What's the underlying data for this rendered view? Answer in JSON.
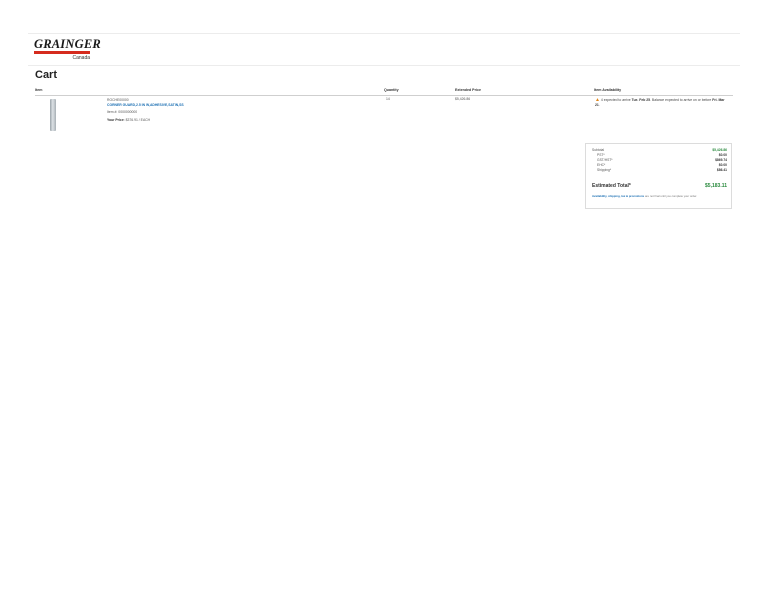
{
  "header": {
    "logo_word": "GRAINGER",
    "logo_sub": "Canada",
    "brand_color": "#d52b1e"
  },
  "page_title": "Cart",
  "columns": {
    "item": "Item",
    "quantity": "Quantity",
    "extended_price": "Extended Price",
    "availability": "Item Availability"
  },
  "line_item": {
    "image_icon": "corner-guard-product-image",
    "part_number": "ROCHE00000",
    "product_name": "CORNER GUARD,2.5 IN W,ADHESIVE,SATIN,SS",
    "item_number": "Item #: 0000000000",
    "price_label": "Your Price",
    "price_value": ": $376.91 / EACH",
    "quantity": "14",
    "extended_price": "$5,426.86",
    "availability": {
      "icon": "warning-icon",
      "prefix": "4 expected to arrive",
      "date1": "Tue. Feb 25",
      "middle": ". Balance expected to arrive on or before",
      "date2": "Fri. Mar 21",
      "suffix": "."
    }
  },
  "summary": {
    "rows": [
      {
        "label": "Subtotal",
        "value": "$5,426.86",
        "green": true,
        "indent": false
      },
      {
        "label": "PST*",
        "value": "$0.00",
        "green": false,
        "indent": true
      },
      {
        "label": "GST/HST*",
        "value": "$869.74",
        "green": false,
        "indent": true
      },
      {
        "label": "EHC*",
        "value": "$0.00",
        "green": false,
        "indent": true
      },
      {
        "label": "Shipping*",
        "value": "$86.41",
        "green": false,
        "indent": true
      }
    ],
    "estimated_total_label": "Estimated Total*",
    "estimated_total_value": "$5,183.11",
    "note_lead": "Availability, shipping, tax & promotions",
    "note_rest": "are not final until you complete your order.",
    "accent_green": "#2a8a3e",
    "link_blue": "#1b6fb3"
  }
}
